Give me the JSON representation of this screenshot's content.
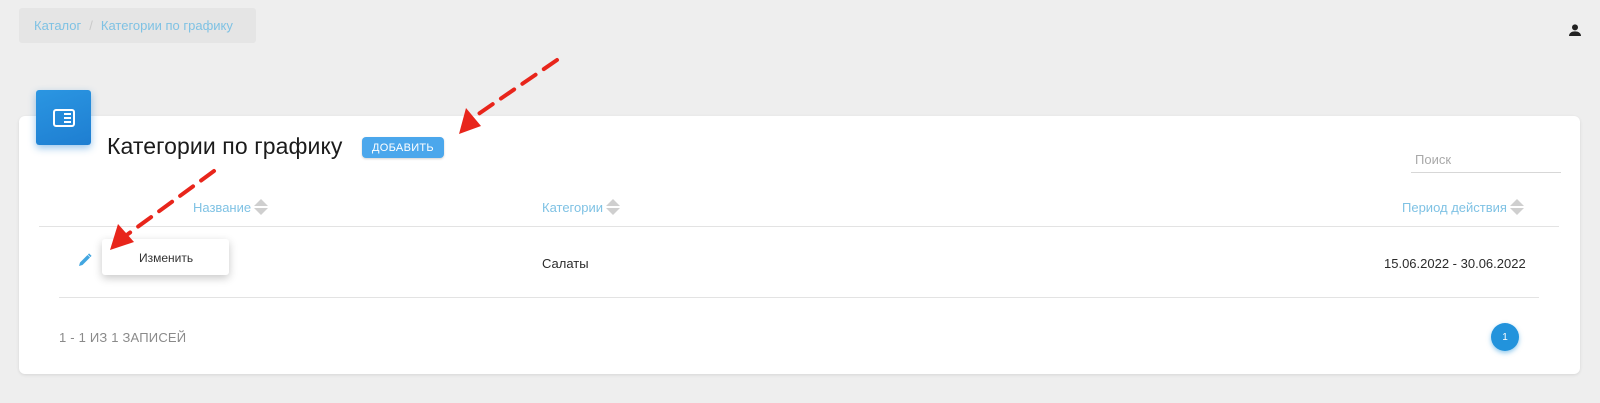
{
  "breadcrumb": {
    "items": [
      "Каталог",
      "Категории по графику"
    ],
    "separator": "/"
  },
  "header": {
    "user_icon": "person-icon"
  },
  "card": {
    "icon": "catalog-icon",
    "title": "Категории по графику",
    "add_label": "ДОБАВИТЬ",
    "search_placeholder": "Поиск"
  },
  "table": {
    "columns": [
      "Название",
      "Категории",
      "Период действия"
    ],
    "rows": [
      {
        "name": "",
        "category": "Салаты",
        "period": "15.06.2022 - 30.06.2022"
      }
    ],
    "row_action_icon": "pencil-icon",
    "tooltip": "Изменить"
  },
  "footer": {
    "count_text": "1 - 1 ИЗ 1 ЗАПИСЕЙ",
    "pages": [
      "1"
    ]
  },
  "colors": {
    "accent": "#2293dc",
    "link": "#7fc2e4",
    "button": "#4ba7ec",
    "annotation": "#e8251b"
  }
}
